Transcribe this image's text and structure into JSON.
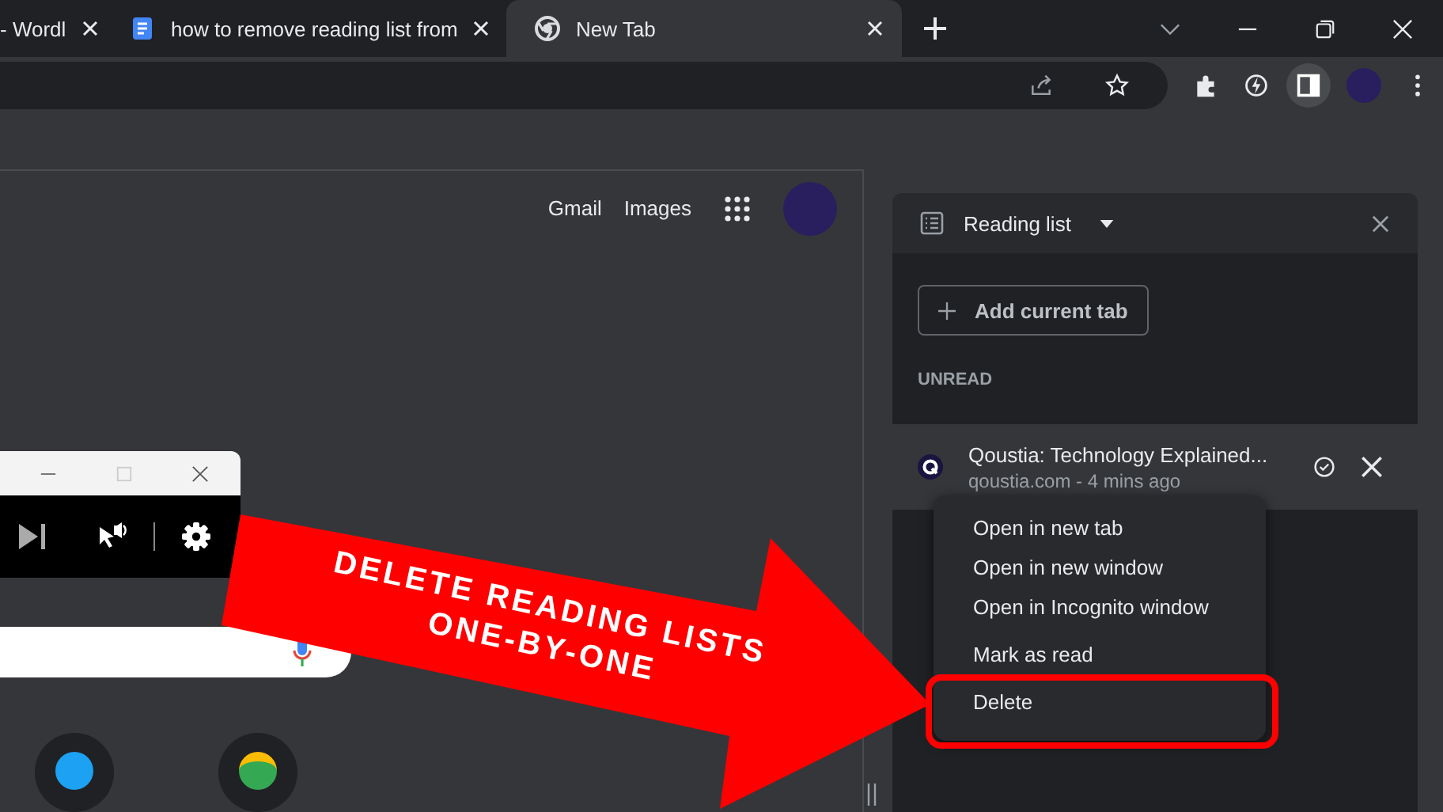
{
  "tabs": [
    {
      "title": "- Wordl",
      "selected": false
    },
    {
      "title": "how to remove reading list from",
      "selected": false
    },
    {
      "title": "New Tab",
      "selected": true
    }
  ],
  "new_tab_page": {
    "links": [
      "Gmail",
      "Images"
    ]
  },
  "reading_list": {
    "title": "Reading list",
    "add_button": "Add current tab",
    "section": "UNREAD",
    "items": [
      {
        "title": "Qoustia: Technology Explained...",
        "meta": "qoustia.com - 4 mins ago"
      }
    ]
  },
  "context_menu": {
    "groups": [
      [
        "Open in new tab",
        "Open in new window",
        "Open in Incognito window"
      ],
      [
        "Mark as read",
        "Delete"
      ]
    ]
  },
  "callout": {
    "lines": [
      "DELETE READING LISTS",
      "ONE-BY-ONE"
    ]
  }
}
